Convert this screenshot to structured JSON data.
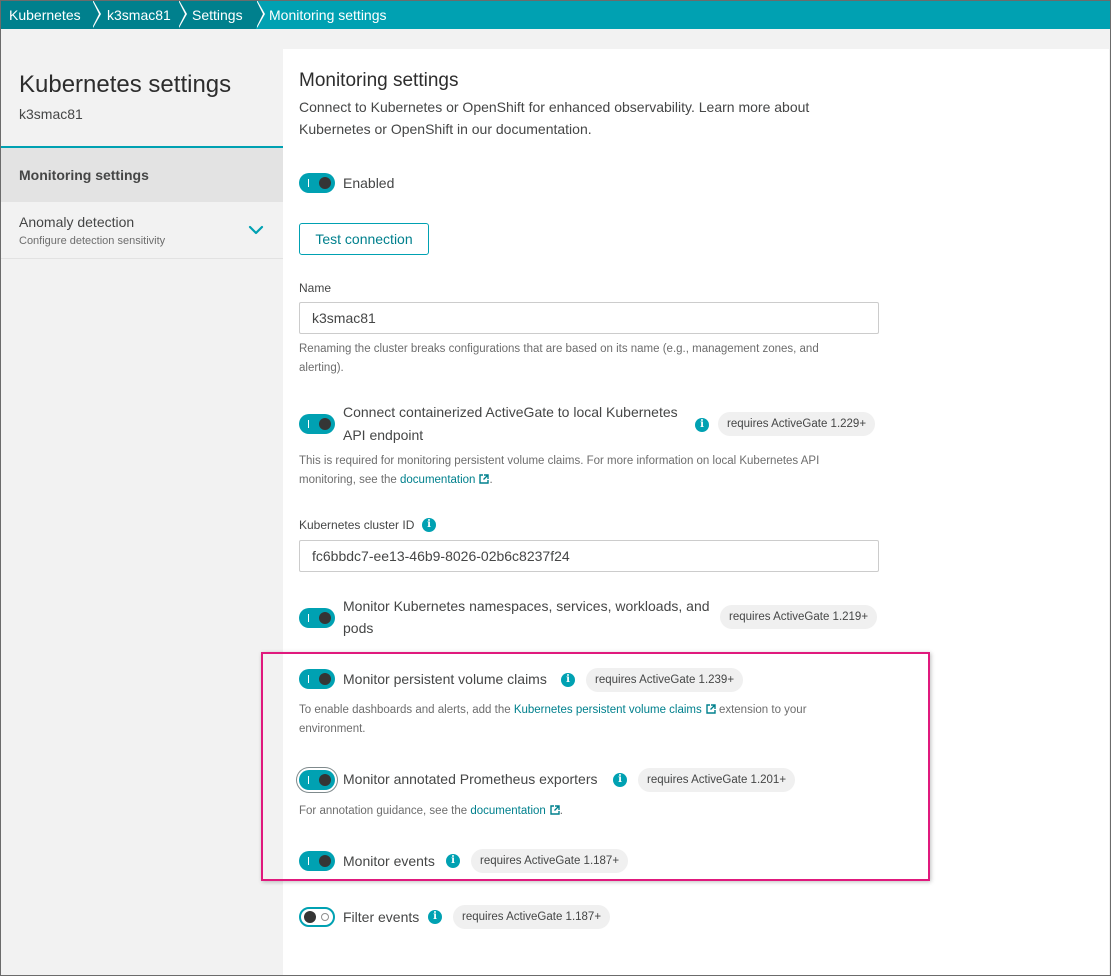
{
  "breadcrumbs": [
    "Kubernetes",
    "k3smac81",
    "Settings",
    "Monitoring settings"
  ],
  "sidebar": {
    "title": "Kubernetes settings",
    "subtitle": "k3smac81",
    "items": [
      {
        "label": "Monitoring settings",
        "active": true
      },
      {
        "label": "Anomaly detection",
        "description": "Configure detection sensitivity",
        "icon": "chevron-down-icon"
      }
    ]
  },
  "main": {
    "title": "Monitoring settings",
    "intro_line1": "Connect to Kubernetes or OpenShift for enhanced observability. Learn more about",
    "intro_line2": "Kubernetes or OpenShift in our documentation.",
    "enabled_label": "Enabled",
    "test_button": "Test connection",
    "name_label": "Name",
    "name_value": "k3smac81",
    "name_help_line1": "Renaming the cluster breaks configurations that are based on its name (e.g., management zones, and",
    "name_help_line2": "alerting).",
    "activegate_label_line1": "Connect containerized ActiveGate to local Kubernetes",
    "activegate_label_line2": "API endpoint",
    "activegate_badge": "requires ActiveGate 1.229+",
    "activegate_help_line1": "This is required for monitoring persistent volume claims. For more information on local Kubernetes API",
    "activegate_help_line2_prefix": "monitoring, see the ",
    "activegate_help_link": "documentation",
    "activegate_help_suffix": ".",
    "cluster_id_label": "Kubernetes cluster ID",
    "cluster_id_value": "fc6bbdc7-ee13-46b9-8026-02b6c8237f24",
    "ns_label_line1": "Monitor Kubernetes namespaces, services, workloads, and",
    "ns_label_line2": "pods",
    "ns_badge": "requires ActiveGate 1.219+",
    "pvc_label": "Monitor persistent volume claims",
    "pvc_badge": "requires ActiveGate 1.239+",
    "pvc_help_prefix": "To enable dashboards and alerts, add the ",
    "pvc_help_link": "Kubernetes persistent volume claims",
    "pvc_help_suffix": " extension to your",
    "pvc_help_line2": "environment.",
    "prom_label": "Monitor annotated Prometheus exporters",
    "prom_badge": "requires ActiveGate 1.201+",
    "prom_help_prefix": "For annotation guidance, see the ",
    "prom_help_link": "documentation",
    "prom_help_suffix": ".",
    "events_label": "Monitor events",
    "events_badge": "requires ActiveGate 1.187+",
    "filter_label": "Filter events",
    "filter_badge": "requires ActiveGate 1.187+"
  },
  "toggles": {
    "enabled": true,
    "activegate": true,
    "namespaces": true,
    "pvc": true,
    "prometheus": true,
    "events": true,
    "filter_events": false
  },
  "colors": {
    "accent": "#00a1b2",
    "accent_dark": "#00808d",
    "highlight": "#e0197d"
  }
}
